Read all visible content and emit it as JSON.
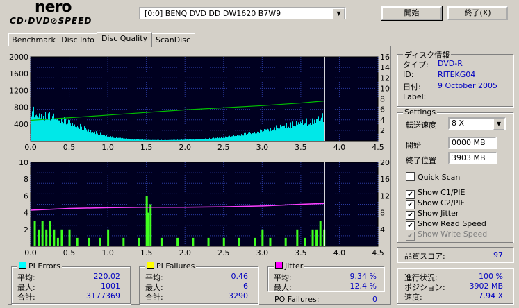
{
  "app": {
    "logo_top": "nero",
    "logo_bottom": "CD·DVD⊘SPEED"
  },
  "drive": {
    "selected": "[0:0]    BENQ DVD DD DW1620 B7W9"
  },
  "buttons": {
    "start": "開始",
    "exit": "終了(X)"
  },
  "tabs": [
    {
      "label": "Benchmark",
      "active": false
    },
    {
      "label": "Disc Info",
      "active": false
    },
    {
      "label": "Disc Quality",
      "active": true
    },
    {
      "label": "ScanDisc",
      "active": false
    }
  ],
  "disc_info": {
    "title": "ディスク情報",
    "type_label": "タイプ:",
    "type_value": "DVD-R",
    "id_label": "ID:",
    "id_value": "RITEKG04",
    "date_label": "日付:",
    "date_value": "9 October 2005",
    "label_label": "Label:",
    "label_value": ""
  },
  "settings": {
    "title": "Settings",
    "speed_label": "転送速度",
    "speed_value": "8 X",
    "start_label": "開始",
    "start_value": "0000 MB",
    "end_label": "終了位置",
    "end_value": "3903 MB",
    "checkboxes": [
      {
        "label": "Quick Scan",
        "checked": false,
        "disabled": false
      },
      {
        "label": "Show C1/PIE",
        "checked": true,
        "disabled": false
      },
      {
        "label": "Show C2/PIF",
        "checked": true,
        "disabled": false
      },
      {
        "label": "Show Jitter",
        "checked": true,
        "disabled": false
      },
      {
        "label": "Show Read Speed",
        "checked": true,
        "disabled": false
      },
      {
        "label": "Show Write Speed",
        "checked": true,
        "disabled": true
      }
    ]
  },
  "quality": {
    "label": "品質スコア:",
    "value": "97"
  },
  "progress": {
    "status_label": "進行状況:",
    "status_value": "100 %",
    "position_label": "ポジション:",
    "position_value": "3902 MB",
    "speed_label": "速度:",
    "speed_value": "7.94 X"
  },
  "pi_errors": {
    "title": "PI Errors",
    "color": "#00ffff",
    "avg_label": "平均:",
    "avg": "220.02",
    "max_label": "最大:",
    "max": "1001",
    "total_label": "合計:",
    "total": "3177369"
  },
  "pi_failures": {
    "title": "PI Failures",
    "color": "#ffff00",
    "avg_label": "平均:",
    "avg": "0.46",
    "max_label": "最大:",
    "max": "6",
    "total_label": "合計:",
    "total": "3290"
  },
  "jitter": {
    "title": "Jitter",
    "color": "#ff00ff",
    "avg_label": "平均:",
    "avg": "9.34 %",
    "max_label": "最大:",
    "max": "12.4 %",
    "po_label": "PO Failures:",
    "po_value": "0"
  },
  "chart_data": [
    {
      "type": "area",
      "name": "PI Errors / Read Speed",
      "x_ticks": [
        "0.0",
        "0.5",
        "1.0",
        "1.5",
        "2.0",
        "2.5",
        "3.0",
        "3.5",
        "4.0",
        "4.5"
      ],
      "y_ticks_left": [
        "2000",
        "1600",
        "1200",
        "800",
        "400"
      ],
      "y_ticks_right": [
        "16",
        "14",
        "12",
        "10",
        "8",
        "6",
        "4",
        "2"
      ],
      "xlim": [
        0,
        4.5
      ],
      "ylim_left": [
        0,
        2000
      ],
      "ylim_right": [
        0,
        16
      ],
      "end_marker_x": 3.81,
      "pie_x": [
        0.0,
        0.1,
        0.2,
        0.3,
        0.4,
        0.5,
        0.6,
        0.7,
        0.8,
        0.9,
        1.0,
        1.1,
        1.2,
        1.3,
        1.4,
        1.5,
        1.6,
        1.7,
        1.8,
        1.9,
        2.0,
        2.1,
        2.2,
        2.3,
        2.4,
        2.5,
        2.6,
        2.7,
        2.8,
        2.9,
        3.0,
        3.1,
        3.2,
        3.3,
        3.4,
        3.5,
        3.6,
        3.7,
        3.8
      ],
      "pie_values": [
        700,
        640,
        600,
        560,
        500,
        440,
        360,
        290,
        220,
        160,
        110,
        80,
        60,
        40,
        30,
        25,
        20,
        20,
        20,
        25,
        30,
        35,
        45,
        55,
        70,
        85,
        110,
        140,
        170,
        200,
        240,
        280,
        320,
        360,
        400,
        430,
        460,
        500,
        560
      ],
      "speed_x": [
        0.0,
        0.5,
        1.0,
        1.5,
        2.0,
        2.5,
        3.0,
        3.5,
        3.81
      ],
      "speed_values": [
        3.9,
        4.4,
        4.9,
        5.4,
        5.9,
        6.3,
        6.7,
        7.2,
        7.6
      ]
    },
    {
      "type": "bar",
      "name": "PI Failures / Jitter",
      "x_ticks": [
        "0.0",
        "0.5",
        "1.0",
        "1.5",
        "2.0",
        "2.5",
        "3.0",
        "3.5",
        "4.0",
        "4.5"
      ],
      "y_ticks_left": [
        "10",
        "8",
        "6",
        "4",
        "2"
      ],
      "y_ticks_right": [
        "20",
        "16",
        "12",
        "8",
        "4"
      ],
      "xlim": [
        0,
        4.5
      ],
      "ylim_left": [
        0,
        10
      ],
      "ylim_right": [
        0,
        20
      ],
      "end_marker_x": 3.81,
      "pif_x": [
        0.05,
        0.1,
        0.15,
        0.2,
        0.25,
        0.3,
        0.35,
        0.4,
        0.5,
        0.6,
        0.75,
        0.9,
        1.0,
        1.2,
        1.4,
        1.5,
        1.52,
        1.55,
        1.7,
        1.9,
        2.1,
        2.3,
        2.5,
        2.7,
        2.9,
        3.0,
        3.1,
        3.3,
        3.45,
        3.55,
        3.65,
        3.7,
        3.75,
        3.8
      ],
      "pif_values": [
        3,
        2,
        3,
        2,
        3,
        2,
        1,
        2,
        2,
        1,
        1,
        1,
        2,
        1,
        1,
        6,
        4,
        5,
        1,
        1,
        1,
        1,
        1,
        1,
        1,
        2,
        1,
        1,
        2,
        1,
        2,
        2,
        3,
        2
      ],
      "jitter_x": [
        0.0,
        0.5,
        1.0,
        1.5,
        2.0,
        2.5,
        3.0,
        3.5,
        3.81
      ],
      "jitter_values": [
        8.6,
        9.0,
        9.2,
        9.3,
        9.3,
        9.4,
        9.6,
        10.0,
        10.2
      ]
    }
  ]
}
